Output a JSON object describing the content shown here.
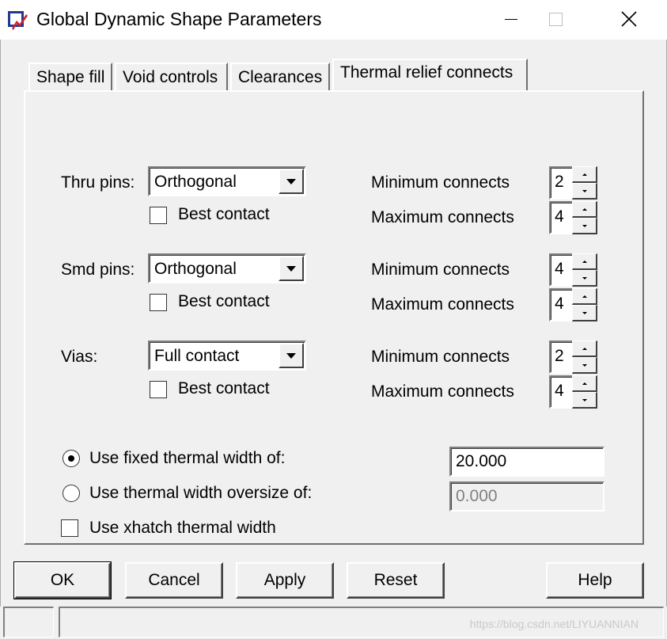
{
  "window": {
    "title": "Global Dynamic Shape Parameters",
    "icon": "allegro-app-icon"
  },
  "tabs": [
    {
      "label": "Shape fill",
      "active": false
    },
    {
      "label": "Void controls",
      "active": false
    },
    {
      "label": "Clearances",
      "active": false
    },
    {
      "label": "Thermal relief connects",
      "active": true
    }
  ],
  "thru_pins": {
    "label": "Thru pins:",
    "value": "Orthogonal",
    "best_contact": {
      "label": "Best contact",
      "checked": false
    },
    "min": {
      "label": "Minimum connects",
      "value": "2"
    },
    "max": {
      "label": "Maximum connects",
      "value": "4"
    }
  },
  "smd_pins": {
    "label": "Smd pins:",
    "value": "Orthogonal",
    "best_contact": {
      "label": "Best contact",
      "checked": false
    },
    "min": {
      "label": "Minimum connects",
      "value": "4"
    },
    "max": {
      "label": "Maximum connects",
      "value": "4"
    }
  },
  "vias": {
    "label": "Vias:",
    "value": "Full contact",
    "best_contact": {
      "label": "Best contact",
      "checked": false
    },
    "min": {
      "label": "Minimum connects",
      "value": "2"
    },
    "max": {
      "label": "Maximum connects",
      "value": "4"
    }
  },
  "width_options": {
    "fixed": {
      "label": "Use fixed thermal width of:",
      "selected": true,
      "value": "20.000"
    },
    "oversize": {
      "label": "Use thermal width oversize of:",
      "selected": false,
      "value": "0.000"
    },
    "xhatch": {
      "label": "Use xhatch thermal width",
      "checked": false
    }
  },
  "buttons": {
    "ok": "OK",
    "cancel": "Cancel",
    "apply": "Apply",
    "reset": "Reset",
    "help": "Help"
  },
  "watermark": "https://blog.csdn.net/LIYUANNIAN"
}
